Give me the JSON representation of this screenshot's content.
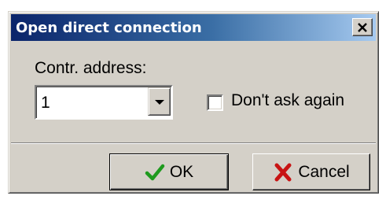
{
  "dialog": {
    "title": "Open direct connection",
    "close_icon": "close-icon"
  },
  "form": {
    "address_label": "Contr. address:",
    "address_value": "1",
    "dont_ask_label": "Don't ask again",
    "dont_ask_checked": false
  },
  "buttons": {
    "ok_label": "OK",
    "ok_icon": "checkmark-icon",
    "cancel_label": "Cancel",
    "cancel_icon": "cross-icon"
  },
  "colors": {
    "titlebar_start": "#0a246a",
    "titlebar_end": "#a6caf0",
    "face": "#d4d0c8",
    "ok_icon": "#1e9a1e",
    "cancel_icon": "#c81414"
  }
}
